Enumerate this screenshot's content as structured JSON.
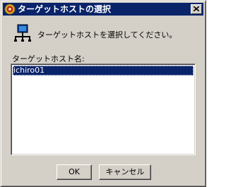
{
  "window": {
    "title": "ターゲットホストの選択",
    "app_icon": "java-app-icon",
    "close_icon": "close-icon"
  },
  "header": {
    "icon": "network-host-icon",
    "instruction": "ターゲットホストを選択してください。"
  },
  "host_list": {
    "label": "ターゲットホスト名:",
    "items": [
      {
        "label": "ichiro01",
        "selected": true
      }
    ]
  },
  "buttons": {
    "ok_label": "OK",
    "cancel_label": "キャンセル"
  },
  "colors": {
    "title_bar": "#0a246a",
    "dialog_face": "#d4d0c8",
    "selection": "#0a246a"
  }
}
